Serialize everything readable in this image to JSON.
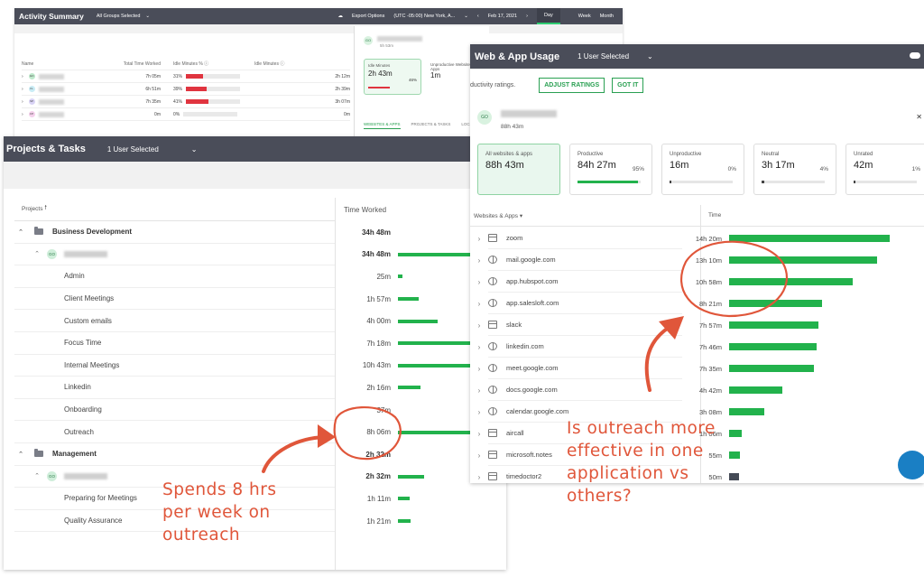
{
  "activity": {
    "title": "Activity Summary",
    "groups": "All Groups Selected",
    "export": "Export Options",
    "timezone": "(UTC -05:00) New York, A...",
    "date": "Feb 17, 2021",
    "tabs": [
      "Day",
      "Week",
      "Month"
    ],
    "columns": [
      "Name",
      "Total Time Worked",
      "Idle Minutes %",
      "Idle Minutes"
    ],
    "rows": [
      {
        "time": "7h 05m",
        "pct": "31%",
        "fill": 0.31,
        "idle": "2h 12m"
      },
      {
        "time": "6h 51m",
        "pct": "39%",
        "fill": 0.39,
        "idle": "2h 39m"
      },
      {
        "time": "7h 35m",
        "pct": "41%",
        "fill": 0.41,
        "idle": "3h 07m"
      },
      {
        "time": "0m",
        "pct": "0%",
        "fill": 0,
        "idle": "0m"
      }
    ],
    "side": {
      "avatar": "GO",
      "hours": "5h 53m",
      "idle_label": "Idle Minutes",
      "idle_value": "2h 43m",
      "idle_pct": "46%",
      "unp_label": "Unproductive Websites & Apps",
      "unp_value": "1m",
      "unp_pct": "0%",
      "tabs": [
        "WEBSITES & APPS",
        "PROJECTS & TASKS",
        "LOC"
      ],
      "sub": "Websites & Apps"
    }
  },
  "projects": {
    "title": "Projects & Tasks",
    "selection": "1 User Selected",
    "col_projects": "Projects",
    "col_time": "Time Worked",
    "rows": [
      {
        "kind": "group",
        "label": "Business Development",
        "time": "34h 48m",
        "bar": 0
      },
      {
        "kind": "user",
        "avatar": "GO",
        "time": "34h 48m",
        "bar": 1.0
      },
      {
        "kind": "task",
        "label": "Admin",
        "time": "25m",
        "bar": 0.04
      },
      {
        "kind": "task",
        "label": "Client Meetings",
        "time": "1h 57m",
        "bar": 0.19
      },
      {
        "kind": "task",
        "label": "Custom emails",
        "time": "4h 00m",
        "bar": 0.37
      },
      {
        "kind": "task",
        "label": "Focus Time",
        "time": "7h 18m",
        "bar": 0.68
      },
      {
        "kind": "task",
        "label": "Internal Meetings",
        "time": "10h 43m",
        "bar": 1.0
      },
      {
        "kind": "task",
        "label": "Linkedin",
        "time": "2h 16m",
        "bar": 0.21
      },
      {
        "kind": "task",
        "label": "Onboarding",
        "time": "37m",
        "bar": 0
      },
      {
        "kind": "task",
        "label": "Outreach",
        "time": "8h 06m",
        "bar": 0.76
      },
      {
        "kind": "group",
        "label": "Management",
        "time": "2h 32m",
        "bar": 0
      },
      {
        "kind": "user",
        "avatar": "GO",
        "time": "2h 32m",
        "bar": 0.24
      },
      {
        "kind": "task",
        "label": "Preparing for Meetings",
        "time": "1h 11m",
        "bar": 0.11
      },
      {
        "kind": "task",
        "label": "Quality Assurance",
        "time": "1h 21m",
        "bar": 0.12
      }
    ]
  },
  "webapp": {
    "title": "Web & App Usage",
    "selection": "1 User Selected",
    "ratings_text": "ductivity ratings.",
    "adjust": "ADJUST RATINGS",
    "gotit": "GOT IT",
    "avatar": "GO",
    "hours": "88h 43m",
    "cards": [
      {
        "label": "All websites & apps",
        "value": "88h 43m",
        "pct": "",
        "fill": 0,
        "active": true
      },
      {
        "label": "Productive",
        "value": "84h 27m",
        "pct": "95%",
        "fill": 0.95
      },
      {
        "label": "Unproductive",
        "value": "16m",
        "pct": "0%",
        "fill": 0.01
      },
      {
        "label": "Neutral",
        "value": "3h 17m",
        "pct": "4%",
        "fill": 0.04
      },
      {
        "label": "Unrated",
        "value": "42m",
        "pct": "1%",
        "fill": 0.01
      }
    ],
    "col_sites": "Websites & Apps",
    "col_time": "Time",
    "rows": [
      {
        "icon": "app",
        "label": "zoom",
        "time": "14h 20m",
        "bar": 1.0,
        "color": "green"
      },
      {
        "icon": "globe",
        "label": "mail.google.com",
        "time": "13h 10m",
        "bar": 0.92,
        "color": "green"
      },
      {
        "icon": "globe",
        "label": "app.hubspot.com",
        "time": "10h 58m",
        "bar": 0.77,
        "color": "green"
      },
      {
        "icon": "globe",
        "label": "app.salesloft.com",
        "time": "8h 21m",
        "bar": 0.58,
        "color": "green"
      },
      {
        "icon": "app",
        "label": "slack",
        "time": "7h 57m",
        "bar": 0.555,
        "color": "green"
      },
      {
        "icon": "globe",
        "label": "linkedin.com",
        "time": "7h 46m",
        "bar": 0.545,
        "color": "green"
      },
      {
        "icon": "globe",
        "label": "meet.google.com",
        "time": "7h 35m",
        "bar": 0.53,
        "color": "green"
      },
      {
        "icon": "globe",
        "label": "docs.google.com",
        "time": "4h 42m",
        "bar": 0.33,
        "color": "green"
      },
      {
        "icon": "globe",
        "label": "calendar.google.com",
        "time": "3h 08m",
        "bar": 0.22,
        "color": "green"
      },
      {
        "icon": "app",
        "label": "aircall",
        "time": "1h 06m",
        "bar": 0.08,
        "color": "green"
      },
      {
        "icon": "app",
        "label": "microsoft.notes",
        "time": "55m",
        "bar": 0.065,
        "color": "green"
      },
      {
        "icon": "app",
        "label": "timedoctor2",
        "time": "50m",
        "bar": 0.06,
        "color": "dark"
      }
    ]
  },
  "annotations": {
    "left": [
      "Spends 8 hrs",
      "per week on",
      "outreach"
    ],
    "right": [
      "Is outreach more",
      "effective in one",
      "application vs",
      "others?"
    ],
    "color": "#e0563a"
  },
  "colors": {
    "header": "#4a4d59",
    "green": "#22b24c",
    "red": "#e0343f",
    "annotation": "#e0563a"
  }
}
